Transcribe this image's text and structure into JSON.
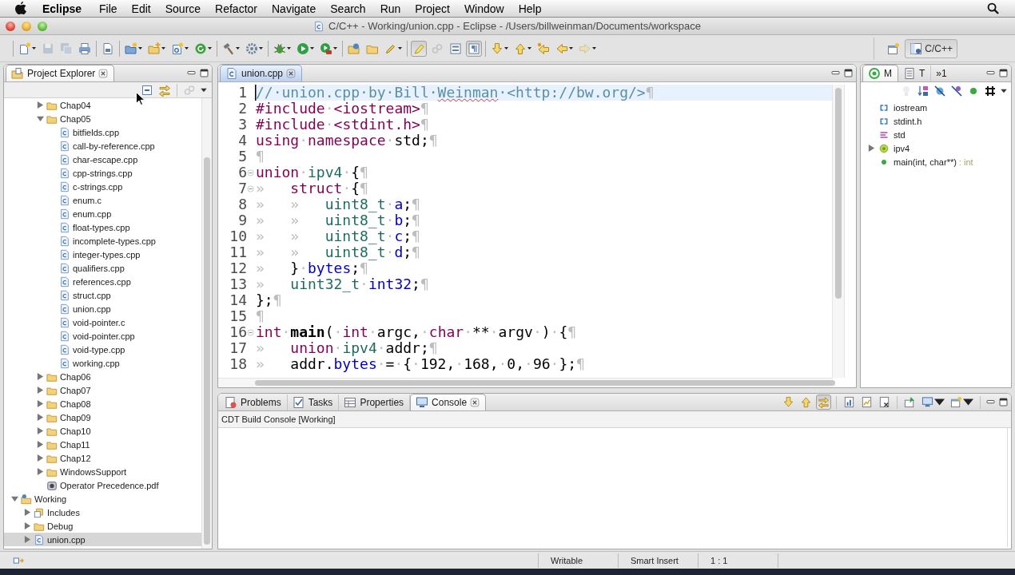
{
  "menu_bar": {
    "app_name": "Eclipse",
    "menus": [
      "File",
      "Edit",
      "Source",
      "Refactor",
      "Navigate",
      "Search",
      "Run",
      "Project",
      "Window",
      "Help"
    ]
  },
  "window": {
    "title": "C/C++ - Working/union.cpp - Eclipse - /Users/billweinman/Documents/workspace"
  },
  "toolbar": {
    "groups": [
      [
        {
          "dropdown": true,
          "disabled": false,
          "pressed": false
        },
        {
          "dropdown": false,
          "disabled": true,
          "pressed": false
        },
        {
          "dropdown": false,
          "disabled": true,
          "pressed": false
        },
        {
          "dropdown": false,
          "disabled": false,
          "pressed": false
        }
      ],
      [
        {
          "dropdown": false,
          "disabled": false,
          "pressed": false
        }
      ],
      [
        {
          "dropdown": true,
          "disabled": false,
          "pressed": false
        },
        {
          "dropdown": true,
          "disabled": false,
          "pressed": false
        },
        {
          "dropdown": true,
          "disabled": false,
          "pressed": false
        },
        {
          "dropdown": true,
          "disabled": false,
          "pressed": false
        }
      ],
      [
        {
          "dropdown": true,
          "disabled": false,
          "pressed": false
        },
        {
          "dropdown": true,
          "disabled": false,
          "pressed": false
        }
      ],
      [
        {
          "dropdown": true,
          "disabled": false,
          "pressed": false
        },
        {
          "dropdown": true,
          "disabled": false,
          "pressed": false
        },
        {
          "dropdown": true,
          "disabled": false,
          "pressed": false
        }
      ],
      [
        {
          "dropdown": false,
          "disabled": false,
          "pressed": false
        },
        {
          "dropdown": false,
          "disabled": false,
          "pressed": false
        },
        {
          "dropdown": true,
          "disabled": false,
          "pressed": false
        }
      ],
      [
        {
          "dropdown": false,
          "disabled": false,
          "pressed": true
        },
        {
          "dropdown": false,
          "disabled": true,
          "pressed": false
        },
        {
          "dropdown": false,
          "disabled": false,
          "pressed": false
        },
        {
          "dropdown": false,
          "disabled": false,
          "pressed": true
        }
      ],
      [
        {
          "dropdown": true,
          "disabled": false,
          "pressed": false
        },
        {
          "dropdown": true,
          "disabled": false,
          "pressed": false
        },
        {
          "dropdown": false,
          "disabled": false,
          "pressed": false
        },
        {
          "dropdown": true,
          "disabled": false,
          "pressed": false
        },
        {
          "dropdown": true,
          "disabled": true,
          "pressed": false
        }
      ]
    ],
    "perspectives": [
      {
        "label": "C/C++",
        "selected": true
      }
    ]
  },
  "project_explorer": {
    "tabs": [
      {
        "label": "Project Explorer",
        "selected": true
      }
    ],
    "toolbar": [
      {
        "disabled": false
      },
      {
        "disabled": false
      },
      {
        "disabled": true
      }
    ],
    "continued_items": [
      {
        "label": "Chap04",
        "kind": "folder",
        "expanded": false,
        "selected": false
      },
      {
        "label": "Chap05",
        "kind": "folder",
        "expanded": true,
        "selected": false,
        "children": [
          {
            "label": "bitfields.cpp",
            "kind": "source",
            "selected": false
          },
          {
            "label": "call-by-reference.cpp",
            "kind": "source",
            "selected": false
          },
          {
            "label": "char-escape.cpp",
            "kind": "source",
            "selected": false
          },
          {
            "label": "cpp-strings.cpp",
            "kind": "source",
            "selected": false
          },
          {
            "label": "c-strings.cpp",
            "kind": "source",
            "selected": false
          },
          {
            "label": "enum.c",
            "kind": "source",
            "selected": false
          },
          {
            "label": "enum.cpp",
            "kind": "source",
            "selected": false
          },
          {
            "label": "float-types.cpp",
            "kind": "source",
            "selected": false
          },
          {
            "label": "incomplete-types.cpp",
            "kind": "source",
            "selected": false
          },
          {
            "label": "integer-types.cpp",
            "kind": "source",
            "selected": false
          },
          {
            "label": "qualifiers.cpp",
            "kind": "source",
            "selected": false
          },
          {
            "label": "references.cpp",
            "kind": "source",
            "selected": false
          },
          {
            "label": "struct.cpp",
            "kind": "source",
            "selected": false
          },
          {
            "label": "union.cpp",
            "kind": "source",
            "selected": false
          },
          {
            "label": "void-pointer.c",
            "kind": "source",
            "selected": false
          },
          {
            "label": "void-pointer.cpp",
            "kind": "source",
            "selected": false
          },
          {
            "label": "void-type.cpp",
            "kind": "source",
            "selected": false
          },
          {
            "label": "working.cpp",
            "kind": "source",
            "selected": false
          }
        ]
      },
      {
        "label": "Chap06",
        "kind": "folder",
        "expanded": false,
        "selected": false
      },
      {
        "label": "Chap07",
        "kind": "folder",
        "expanded": false,
        "selected": false
      },
      {
        "label": "Chap08",
        "kind": "folder",
        "expanded": false,
        "selected": false
      },
      {
        "label": "Chap09",
        "kind": "folder",
        "expanded": false,
        "selected": false
      },
      {
        "label": "Chap10",
        "kind": "folder",
        "expanded": false,
        "selected": false
      },
      {
        "label": "Chap11",
        "kind": "folder",
        "expanded": false,
        "selected": false
      },
      {
        "label": "Chap12",
        "kind": "folder",
        "expanded": false,
        "selected": false
      },
      {
        "label": "WindowsSupport",
        "kind": "folder",
        "expanded": false,
        "selected": false
      },
      {
        "label": "Operator Precedence.pdf",
        "kind": "pdf",
        "selected": false
      }
    ],
    "items": [
      {
        "label": "Working",
        "kind": "project",
        "expanded": true,
        "selected": false,
        "children": [
          {
            "label": "Includes",
            "kind": "includes",
            "expanded": false,
            "selected": false
          },
          {
            "label": "Debug",
            "kind": "folder",
            "expanded": false,
            "selected": false
          },
          {
            "label": "union.cpp",
            "kind": "source",
            "expanded": false,
            "selected": true
          }
        ]
      }
    ]
  },
  "editor": {
    "tabs": [
      {
        "label": "union.cpp",
        "selected": true
      }
    ],
    "lines": [
      {
        "number": "1",
        "current": true,
        "fold_marker": false,
        "tokens": [
          {
            "kind": "comment",
            "text": "//·union.cpp·by·Bill·"
          },
          {
            "kind": "misspelled",
            "text": "Weinman"
          },
          {
            "kind": "comment",
            "text": "·<http://bw.org/>"
          },
          {
            "kind": "eol",
            "text": "¶"
          }
        ]
      },
      {
        "number": "2",
        "current": false,
        "fold_marker": false,
        "tokens": [
          {
            "kind": "preprocessor",
            "text": "#include"
          },
          {
            "kind": "space",
            "text": "·"
          },
          {
            "kind": "preprocessor",
            "text": "<iostream>"
          },
          {
            "kind": "eol",
            "text": "¶"
          }
        ]
      },
      {
        "number": "3",
        "current": false,
        "fold_marker": false,
        "tokens": [
          {
            "kind": "preprocessor",
            "text": "#include"
          },
          {
            "kind": "space",
            "text": "·"
          },
          {
            "kind": "preprocessor",
            "text": "<stdint.h>"
          },
          {
            "kind": "eol",
            "text": "¶"
          }
        ]
      },
      {
        "number": "4",
        "current": false,
        "fold_marker": false,
        "tokens": [
          {
            "kind": "keyword",
            "text": "using"
          },
          {
            "kind": "space",
            "text": "·"
          },
          {
            "kind": "keyword",
            "text": "namespace"
          },
          {
            "kind": "space",
            "text": "·"
          },
          {
            "kind": "plain",
            "text": "std;"
          },
          {
            "kind": "eol",
            "text": "¶"
          }
        ]
      },
      {
        "number": "5",
        "current": false,
        "fold_marker": false,
        "tokens": [
          {
            "kind": "eol",
            "text": "¶"
          }
        ]
      },
      {
        "number": "6",
        "current": false,
        "fold_marker": true,
        "tokens": [
          {
            "kind": "keyword",
            "text": "union"
          },
          {
            "kind": "space",
            "text": "·"
          },
          {
            "kind": "type",
            "text": "ipv4"
          },
          {
            "kind": "space",
            "text": "·"
          },
          {
            "kind": "plain",
            "text": "{"
          },
          {
            "kind": "eol",
            "text": "¶"
          }
        ]
      },
      {
        "number": "7",
        "current": false,
        "fold_marker": true,
        "tokens": [
          {
            "kind": "tab",
            "text": "»"
          },
          {
            "kind": "keyword",
            "text": "struct"
          },
          {
            "kind": "space",
            "text": "·"
          },
          {
            "kind": "plain",
            "text": "{"
          },
          {
            "kind": "eol",
            "text": "¶"
          }
        ]
      },
      {
        "number": "8",
        "current": false,
        "fold_marker": false,
        "tokens": [
          {
            "kind": "tab",
            "text": "»"
          },
          {
            "kind": "tab",
            "text": "»"
          },
          {
            "kind": "type",
            "text": "uint8_t"
          },
          {
            "kind": "space",
            "text": "·"
          },
          {
            "kind": "field",
            "text": "a"
          },
          {
            "kind": "plain",
            "text": ";"
          },
          {
            "kind": "eol",
            "text": "¶"
          }
        ]
      },
      {
        "number": "9",
        "current": false,
        "fold_marker": false,
        "tokens": [
          {
            "kind": "tab",
            "text": "»"
          },
          {
            "kind": "tab",
            "text": "»"
          },
          {
            "kind": "type",
            "text": "uint8_t"
          },
          {
            "kind": "space",
            "text": "·"
          },
          {
            "kind": "field",
            "text": "b"
          },
          {
            "kind": "plain",
            "text": ";"
          },
          {
            "kind": "eol",
            "text": "¶"
          }
        ]
      },
      {
        "number": "10",
        "current": false,
        "fold_marker": false,
        "tokens": [
          {
            "kind": "tab",
            "text": "»"
          },
          {
            "kind": "tab",
            "text": "»"
          },
          {
            "kind": "type",
            "text": "uint8_t"
          },
          {
            "kind": "space",
            "text": "·"
          },
          {
            "kind": "field",
            "text": "c"
          },
          {
            "kind": "plain",
            "text": ";"
          },
          {
            "kind": "eol",
            "text": "¶"
          }
        ]
      },
      {
        "number": "11",
        "current": false,
        "fold_marker": false,
        "tokens": [
          {
            "kind": "tab",
            "text": "»"
          },
          {
            "kind": "tab",
            "text": "»"
          },
          {
            "kind": "type",
            "text": "uint8_t"
          },
          {
            "kind": "space",
            "text": "·"
          },
          {
            "kind": "field",
            "text": "d"
          },
          {
            "kind": "plain",
            "text": ";"
          },
          {
            "kind": "eol",
            "text": "¶"
          }
        ]
      },
      {
        "number": "12",
        "current": false,
        "fold_marker": false,
        "tokens": [
          {
            "kind": "tab",
            "text": "»"
          },
          {
            "kind": "plain",
            "text": "}"
          },
          {
            "kind": "space",
            "text": "·"
          },
          {
            "kind": "field",
            "text": "bytes"
          },
          {
            "kind": "plain",
            "text": ";"
          },
          {
            "kind": "eol",
            "text": "¶"
          }
        ]
      },
      {
        "number": "13",
        "current": false,
        "fold_marker": false,
        "tokens": [
          {
            "kind": "tab",
            "text": "»"
          },
          {
            "kind": "type",
            "text": "uint32_t"
          },
          {
            "kind": "space",
            "text": "·"
          },
          {
            "kind": "field",
            "text": "int32"
          },
          {
            "kind": "plain",
            "text": ";"
          },
          {
            "kind": "eol",
            "text": "¶"
          }
        ]
      },
      {
        "number": "14",
        "current": false,
        "fold_marker": false,
        "tokens": [
          {
            "kind": "plain",
            "text": "};"
          },
          {
            "kind": "eol",
            "text": "¶"
          }
        ]
      },
      {
        "number": "15",
        "current": false,
        "fold_marker": false,
        "tokens": [
          {
            "kind": "eol",
            "text": "¶"
          }
        ]
      },
      {
        "number": "16",
        "current": false,
        "fold_marker": true,
        "tokens": [
          {
            "kind": "keyword",
            "text": "int"
          },
          {
            "kind": "space",
            "text": "·"
          },
          {
            "kind": "function",
            "text": "main"
          },
          {
            "kind": "plain",
            "text": "("
          },
          {
            "kind": "space",
            "text": "·"
          },
          {
            "kind": "keyword",
            "text": "int"
          },
          {
            "kind": "space",
            "text": "·"
          },
          {
            "kind": "plain",
            "text": "argc,"
          },
          {
            "kind": "space",
            "text": "·"
          },
          {
            "kind": "keyword",
            "text": "char"
          },
          {
            "kind": "space",
            "text": "·"
          },
          {
            "kind": "plain",
            "text": "**"
          },
          {
            "kind": "space",
            "text": "·"
          },
          {
            "kind": "plain",
            "text": "argv"
          },
          {
            "kind": "space",
            "text": "·"
          },
          {
            "kind": "plain",
            "text": ")"
          },
          {
            "kind": "space",
            "text": "·"
          },
          {
            "kind": "plain",
            "text": "{"
          },
          {
            "kind": "eol",
            "text": "¶"
          }
        ]
      },
      {
        "number": "17",
        "current": false,
        "fold_marker": false,
        "tokens": [
          {
            "kind": "tab",
            "text": "»"
          },
          {
            "kind": "keyword",
            "text": "union"
          },
          {
            "kind": "space",
            "text": "·"
          },
          {
            "kind": "type",
            "text": "ipv4"
          },
          {
            "kind": "space",
            "text": "·"
          },
          {
            "kind": "plain",
            "text": "addr;"
          },
          {
            "kind": "eol",
            "text": "¶"
          }
        ]
      },
      {
        "number": "18",
        "current": false,
        "fold_marker": false,
        "tokens": [
          {
            "kind": "tab",
            "text": "»"
          },
          {
            "kind": "plain",
            "text": "addr."
          },
          {
            "kind": "field",
            "text": "bytes"
          },
          {
            "kind": "space",
            "text": "·"
          },
          {
            "kind": "plain",
            "text": "="
          },
          {
            "kind": "space",
            "text": "·"
          },
          {
            "kind": "plain",
            "text": "{"
          },
          {
            "kind": "space",
            "text": "·"
          },
          {
            "kind": "plain",
            "text": "192,"
          },
          {
            "kind": "space",
            "text": "·"
          },
          {
            "kind": "plain",
            "text": "168,"
          },
          {
            "kind": "space",
            "text": "·"
          },
          {
            "kind": "plain",
            "text": "0,"
          },
          {
            "kind": "space",
            "text": "·"
          },
          {
            "kind": "plain",
            "text": "96"
          },
          {
            "kind": "space",
            "text": "·"
          },
          {
            "kind": "plain",
            "text": "};"
          },
          {
            "kind": "eol",
            "text": "¶"
          }
        ]
      }
    ]
  },
  "outline": {
    "tabs": [
      {
        "label": "M",
        "selected": true
      },
      {
        "label": "T",
        "selected": false
      }
    ],
    "more_tabs": "»1",
    "toolbar": [
      {
        "disabled": true
      },
      {
        "disabled": false
      },
      {
        "disabled": false
      },
      {
        "disabled": false
      },
      {
        "disabled": false
      },
      {
        "disabled": false
      }
    ],
    "items": [
      {
        "label": "iostream",
        "kind": "include",
        "selected": false
      },
      {
        "label": "stdint.h",
        "kind": "include",
        "selected": false
      },
      {
        "label": "std",
        "kind": "namespace",
        "selected": false
      },
      {
        "label": "ipv4",
        "kind": "union",
        "expanded": false,
        "selected": false
      },
      {
        "label": "main(int, char**)",
        "return_type": ": int",
        "kind": "function",
        "selected": false
      }
    ]
  },
  "console_panel": {
    "tabs": [
      {
        "label": "Problems",
        "selected": false
      },
      {
        "label": "Tasks",
        "selected": false
      },
      {
        "label": "Properties",
        "selected": false
      },
      {
        "label": "Console",
        "selected": true
      }
    ],
    "toolbar": [
      {
        "dropdown": false,
        "pressed": false
      },
      {
        "dropdown": false,
        "pressed": false
      },
      {
        "dropdown": false,
        "pressed": true
      },
      {
        "dropdown": false,
        "pressed": false
      },
      {
        "dropdown": false,
        "pressed": false
      },
      {
        "dropdown": false,
        "pressed": false
      },
      {
        "dropdown": false,
        "pressed": false
      },
      {
        "dropdown": true,
        "pressed": false
      },
      {
        "dropdown": true,
        "pressed": false
      }
    ],
    "console_title": "CDT Build Console [Working]"
  },
  "status_bar": {
    "fields": [
      "Writable",
      "Smart Insert",
      "1 : 1"
    ]
  }
}
